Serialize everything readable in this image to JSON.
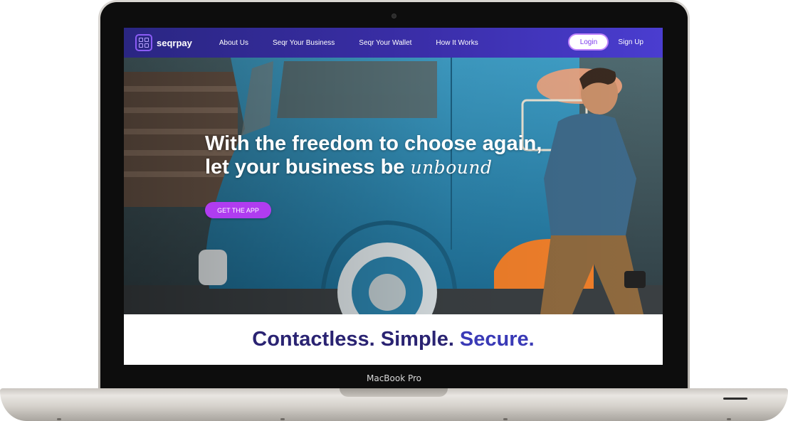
{
  "device": {
    "label": "MacBook Pro"
  },
  "navbar": {
    "brand": "seqrpay",
    "logo_icon": "qr-grid-icon",
    "links": [
      {
        "label": "About Us"
      },
      {
        "label": "Seqr Your Business"
      },
      {
        "label": "Seqr Your Wallet"
      },
      {
        "label": "How It Works"
      }
    ],
    "login_label": "Login",
    "signup_label": "Sign Up"
  },
  "hero": {
    "title_line1": "With the freedom to choose again,",
    "title_line2_prefix": "let your business be",
    "title_script_word": "unbound",
    "cta_label": "GET THE APP"
  },
  "tagline": {
    "part1": "Contactless. Simple.",
    "part2": "Secure."
  },
  "colors": {
    "nav_start": "#2a2682",
    "nav_end": "#4a3dd0",
    "cta": "#b03cf0",
    "tagline_dark": "#2a2372",
    "tagline_accent": "#3a3ab6"
  }
}
